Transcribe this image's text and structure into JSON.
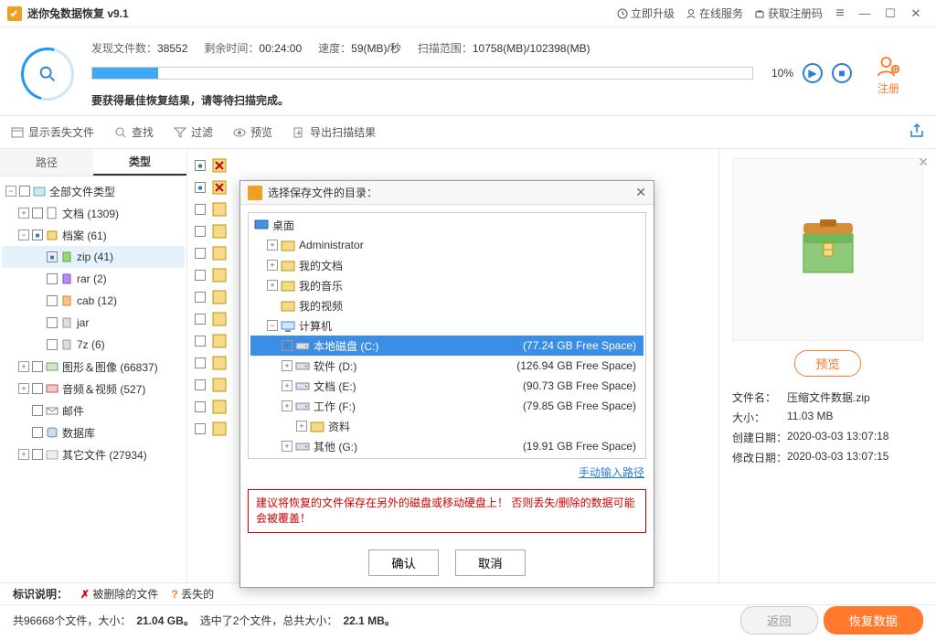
{
  "app": {
    "title": "迷你兔数据恢复 v9.1"
  },
  "toplinks": {
    "upgrade": "立即升级",
    "online": "在线服务",
    "regcode": "获取注册码"
  },
  "scan": {
    "found_lbl": "发现文件数：",
    "found": "38552",
    "remain_lbl": "剩余时间：",
    "remain": "00:24:00",
    "speed_lbl": "速度：",
    "speed": "59(MB)/秒",
    "range_lbl": "扫描范围：",
    "range": "10758(MB)/102398(MB)",
    "pct": "10%",
    "msg": "要获得最佳恢复结果，请等待扫描完成。"
  },
  "toolbar": {
    "lost": "显示丢失文件",
    "find": "查找",
    "filter": "过滤",
    "preview": "预览",
    "export": "导出扫描结果"
  },
  "tabs": {
    "path": "路径",
    "type": "类型"
  },
  "tree": {
    "all": "全部文件类型",
    "doc": "文档 (1309)",
    "archive": "档案 (61)",
    "zip": "zip (41)",
    "rar": "rar (2)",
    "cab": "cab (12)",
    "jar": "jar",
    "sevenz": "7z (6)",
    "image": "图形＆图像 (66837)",
    "audio": "音频＆视频 (527)",
    "mail": "邮件",
    "db": "数据库",
    "other": "其它文件 (27934)"
  },
  "preview": {
    "btn": "预览",
    "name_lbl": "文件名：",
    "name": "压缩文件数据.zip",
    "size_lbl": "大小：",
    "size": "11.03 MB",
    "ctime_lbl": "创建日期：",
    "ctime": "2020-03-03 13:07:18",
    "mtime_lbl": "修改日期：",
    "mtime": "2020-03-03 13:07:15"
  },
  "legend": {
    "label": "标识说明：",
    "deleted": "被删除的文件",
    "lost": "丢失的"
  },
  "status": {
    "total_a": "共96668个文件，大小：",
    "total_b": "21.04 GB。",
    "sel_a": "选中了2个文件，总共大小：",
    "sel_b": "22.1 MB。",
    "back": "返回",
    "recover": "恢复数据"
  },
  "register": "注册",
  "dialog": {
    "title": "选择保存文件的目录：",
    "desktop": "桌面",
    "admin": "Administrator",
    "docs": "我的文档",
    "music": "我的音乐",
    "video": "我的视频",
    "computer": "计算机",
    "drives": [
      {
        "label": "本地磁盘 (C:)",
        "free": "(77.24 GB Free Space)",
        "sel": true
      },
      {
        "label": "软件 (D:)",
        "free": "(126.94 GB Free Space)"
      },
      {
        "label": "文档 (E:)",
        "free": "(90.73 GB Free Space)"
      },
      {
        "label": "工作 (F:)",
        "free": "(79.85 GB Free Space)"
      },
      {
        "label": "其他 (G:)",
        "free": "(19.91 GB Free Space)"
      }
    ],
    "ziliao": "资料",
    "manual": "手动输入路径",
    "warn": "建议将恢复的文件保存在另外的磁盘或移动硬盘上！ 否则丢失/删除的数据可能会被覆盖！",
    "ok": "确认",
    "cancel": "取消"
  }
}
